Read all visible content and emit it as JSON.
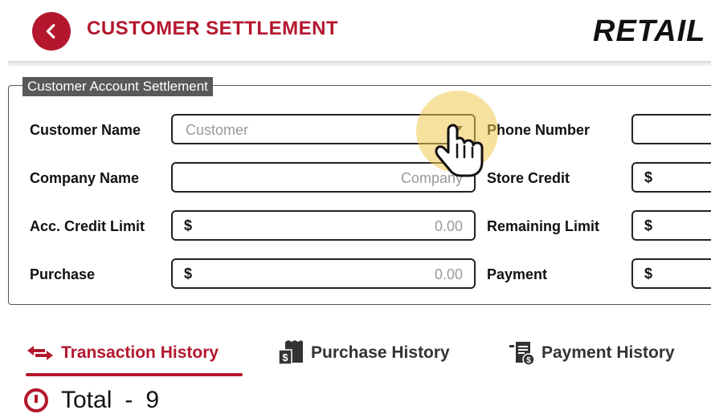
{
  "header": {
    "title": "CUSTOMER SETTLEMENT",
    "brand": "RETAIL"
  },
  "colors": {
    "accent": "#b3172e",
    "legend_bg": "#595959",
    "highlight": "#f0c850"
  },
  "form": {
    "legend": "Customer Account Settlement",
    "customer_name": {
      "label": "Customer Name",
      "placeholder": "Customer"
    },
    "phone_number": {
      "label": "Phone Number"
    },
    "company_name": {
      "label": "Company Name",
      "placeholder": "Company"
    },
    "store_credit": {
      "label": "Store Credit",
      "currency": "$"
    },
    "acc_credit_limit": {
      "label": "Acc. Credit Limit",
      "currency": "$",
      "value": "0.00"
    },
    "remaining_limit": {
      "label": "Remaining Limit",
      "currency": "$"
    },
    "purchase": {
      "label": "Purchase",
      "currency": "$",
      "value": "0.00"
    },
    "payment": {
      "label": "Payment",
      "currency": "$"
    }
  },
  "tabs": [
    {
      "label": "Transaction History",
      "icon": "transfer-arrows-icon",
      "active": true
    },
    {
      "label": "Purchase History",
      "icon": "receipt-dollar-icon",
      "active": false
    },
    {
      "label": "Payment History",
      "icon": "payment-receipt-icon",
      "active": false
    }
  ],
  "summary": {
    "total_label": "Total",
    "total_value": "9",
    "total_separator": "-"
  }
}
